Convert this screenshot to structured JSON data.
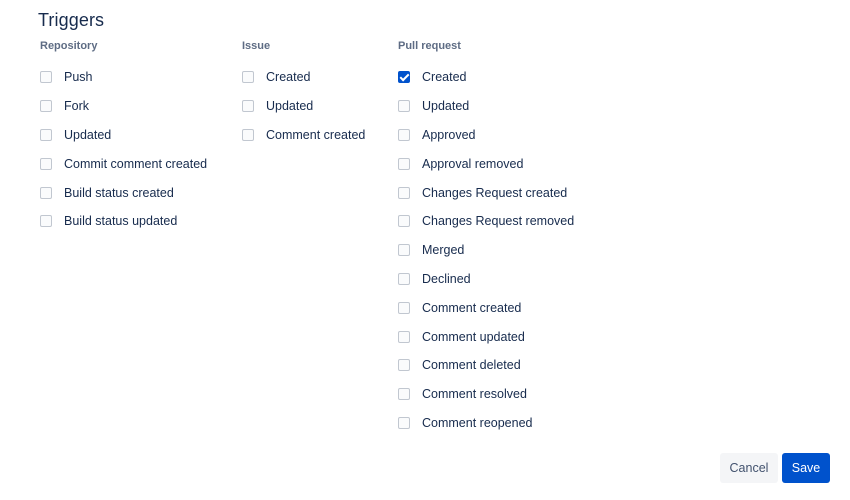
{
  "title": "Triggers",
  "columns": {
    "repository": {
      "header": "Repository",
      "options": [
        {
          "label": "Push",
          "checked": false
        },
        {
          "label": "Fork",
          "checked": false
        },
        {
          "label": "Updated",
          "checked": false
        },
        {
          "label": "Commit comment created",
          "checked": false
        },
        {
          "label": "Build status created",
          "checked": false
        },
        {
          "label": "Build status updated",
          "checked": false
        }
      ]
    },
    "issue": {
      "header": "Issue",
      "options": [
        {
          "label": "Created",
          "checked": false
        },
        {
          "label": "Updated",
          "checked": false
        },
        {
          "label": "Comment created",
          "checked": false
        }
      ]
    },
    "pull_request": {
      "header": "Pull request",
      "options": [
        {
          "label": "Created",
          "checked": true
        },
        {
          "label": "Updated",
          "checked": false
        },
        {
          "label": "Approved",
          "checked": false
        },
        {
          "label": "Approval removed",
          "checked": false
        },
        {
          "label": "Changes Request created",
          "checked": false
        },
        {
          "label": "Changes Request removed",
          "checked": false
        },
        {
          "label": "Merged",
          "checked": false
        },
        {
          "label": "Declined",
          "checked": false
        },
        {
          "label": "Comment created",
          "checked": false
        },
        {
          "label": "Comment updated",
          "checked": false
        },
        {
          "label": "Comment deleted",
          "checked": false
        },
        {
          "label": "Comment resolved",
          "checked": false
        },
        {
          "label": "Comment reopened",
          "checked": false
        }
      ]
    }
  },
  "buttons": {
    "cancel": "Cancel",
    "save": "Save"
  },
  "colors": {
    "accent": "#0052cc",
    "text": "#172b4d",
    "subtle_text": "#5e6c84"
  }
}
